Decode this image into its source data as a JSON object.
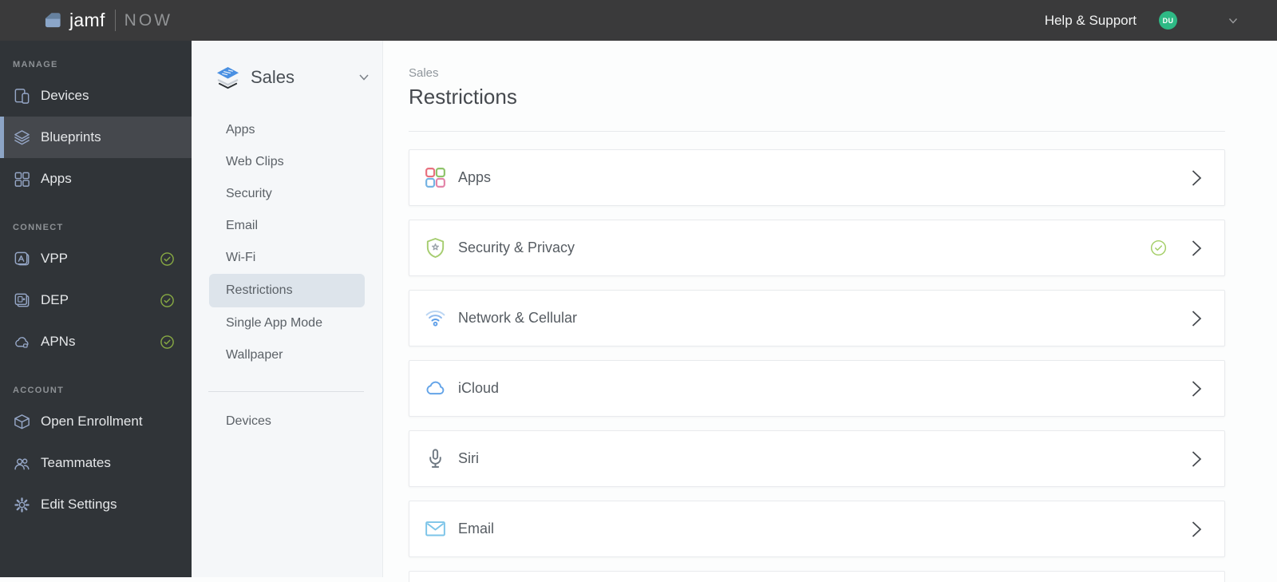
{
  "topbar": {
    "brand_name": "jamf",
    "brand_suffix": "NOW",
    "help_label": "Help & Support",
    "avatar_initials": "DU"
  },
  "sidebar": {
    "sections": [
      {
        "label": "MANAGE",
        "items": [
          {
            "label": "Devices",
            "icon": "devices-icon",
            "selected": false
          },
          {
            "label": "Blueprints",
            "icon": "blueprints-icon",
            "selected": true
          },
          {
            "label": "Apps",
            "icon": "apps-icon",
            "selected": false
          }
        ]
      },
      {
        "label": "CONNECT",
        "items": [
          {
            "label": "VPP",
            "icon": "vpp-icon",
            "status": "connected"
          },
          {
            "label": "DEP",
            "icon": "dep-icon",
            "status": "connected"
          },
          {
            "label": "APNs",
            "icon": "apns-icon",
            "status": "connected"
          }
        ]
      },
      {
        "label": "ACCOUNT",
        "items": [
          {
            "label": "Open Enrollment",
            "icon": "open-enrollment-icon"
          },
          {
            "label": "Teammates",
            "icon": "teammates-icon"
          },
          {
            "label": "Edit Settings",
            "icon": "gear-icon"
          }
        ]
      }
    ]
  },
  "blueprint_panel": {
    "title": "Sales",
    "icon": "blueprint-stack-icon",
    "items": [
      "Apps",
      "Web Clips",
      "Security",
      "Email",
      "Wi-Fi",
      "Restrictions",
      "Single App Mode",
      "Wallpaper"
    ],
    "selected_item": "Restrictions",
    "footer_item": "Devices"
  },
  "main": {
    "breadcrumb": "Sales",
    "title": "Restrictions",
    "cards": [
      {
        "label": "Apps",
        "icon": "apps-grid-icon",
        "configured": false
      },
      {
        "label": "Security & Privacy",
        "icon": "shield-icon",
        "configured": true
      },
      {
        "label": "Network & Cellular",
        "icon": "wifi-icon",
        "configured": false
      },
      {
        "label": "iCloud",
        "icon": "cloud-icon",
        "configured": false
      },
      {
        "label": "Siri",
        "icon": "microphone-icon",
        "configured": false
      },
      {
        "label": "Email",
        "icon": "envelope-icon",
        "configured": false
      }
    ]
  },
  "colors": {
    "topbar_bg": "#3a3a3b",
    "sidebar_bg": "#303438",
    "sidebar_icon": "#95a6c6",
    "sidebar_selected_accent": "#8da5c6",
    "avatar_green": "#2eb985",
    "sidebar_check_green": "#87a943",
    "card_check_green": "#a4ce66",
    "selected_pill": "#dde4eb",
    "blueprint_blue": "#4a90e2",
    "apps_grid": [
      "#e8707e",
      "#8fc36a",
      "#74b3e3",
      "#e383a8"
    ],
    "wifi_blue": "#5f9fe8",
    "cloud_blue": "#64a4e8",
    "envelope_blue": "#7cc4e8"
  }
}
